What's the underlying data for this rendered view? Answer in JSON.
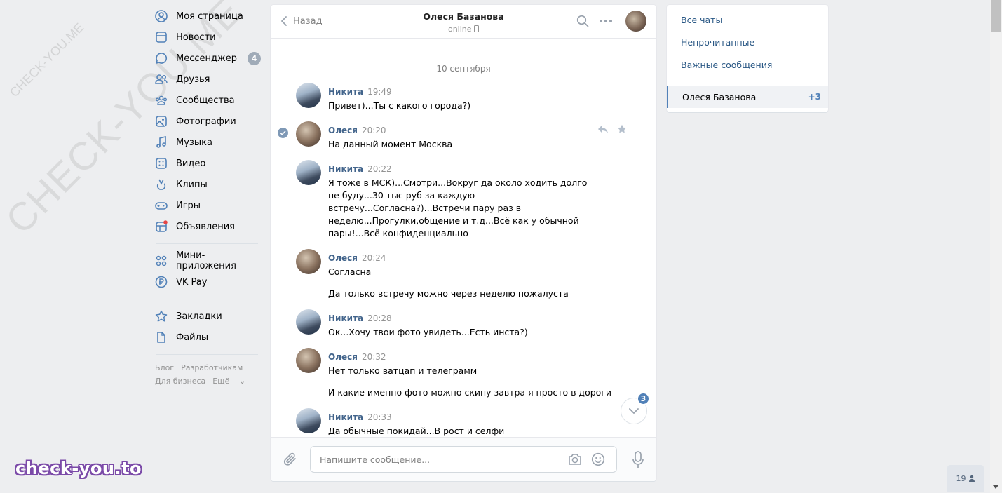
{
  "watermark": {
    "big": "CHECK-YOU.ME",
    "small": "CHECK-YOU.ME",
    "brand": "check-you.to"
  },
  "nav": {
    "items": [
      {
        "label": "Моя страница",
        "icon": "user-circle-icon"
      },
      {
        "label": "Новости",
        "icon": "news-icon"
      },
      {
        "label": "Мессенджер",
        "icon": "message-icon",
        "badge": "4"
      },
      {
        "label": "Друзья",
        "icon": "friends-icon"
      },
      {
        "label": "Сообщества",
        "icon": "communities-icon"
      },
      {
        "label": "Фотографии",
        "icon": "photo-icon"
      },
      {
        "label": "Музыка",
        "icon": "music-icon"
      },
      {
        "label": "Видео",
        "icon": "video-icon"
      },
      {
        "label": "Клипы",
        "icon": "clips-icon"
      },
      {
        "label": "Игры",
        "icon": "gamepad-icon"
      },
      {
        "label": "Объявления",
        "icon": "ads-icon"
      }
    ],
    "items2": [
      {
        "label": "Мини-приложения",
        "icon": "apps-icon"
      },
      {
        "label": "VK Pay",
        "icon": "vkpay-icon"
      }
    ],
    "items3": [
      {
        "label": "Закладки",
        "icon": "star-icon"
      },
      {
        "label": "Файлы",
        "icon": "file-icon"
      }
    ],
    "footer": [
      "Блог",
      "Разработчикам",
      "Для бизнеса",
      "Ещё"
    ]
  },
  "chat": {
    "back_label": "Назад",
    "peer_name": "Олеся Базанова",
    "peer_status": "online",
    "date": "10 сентября",
    "messages": [
      {
        "author": "Никита",
        "time": "19:49",
        "texts": [
          "Привет)...Ты с какого города?)"
        ],
        "who": "n"
      },
      {
        "author": "Олеся",
        "time": "20:20",
        "texts": [
          "На данный момент Москва"
        ],
        "who": "o"
      },
      {
        "author": "Никита",
        "time": "20:22",
        "texts": [
          "Я тоже в МСК)...Смотри...Вокруг да около ходить долго не буду...30 тыс руб за каждую встречу...Согласна?)...Встречи пару раз в неделю...Прогулки,общение и т.д...Всё как у обычной пары!...Всё конфиденциально"
        ],
        "who": "n"
      },
      {
        "author": "Олеся",
        "time": "20:24",
        "texts": [
          "Согласна",
          "Да только встречу можно через неделю пожалуста"
        ],
        "who": "o"
      },
      {
        "author": "Никита",
        "time": "20:28",
        "texts": [
          "Ок...Хочу твои фото увидеть...Есть инста?)"
        ],
        "who": "n"
      },
      {
        "author": "Олеся",
        "time": "20:32",
        "texts": [
          "Нет только ватцап и телеграмм",
          "И какие именно фото можно скину завтра я просто в дороги"
        ],
        "who": "o"
      },
      {
        "author": "Никита",
        "time": "20:33",
        "texts": [
          "Да обычные покидай...В рост и селфи"
        ],
        "who": "n"
      }
    ],
    "unread_count": "3",
    "composer_placeholder": "Напишите сообщение..."
  },
  "right": {
    "folders": [
      "Все чаты",
      "Непрочитанные",
      "Важные сообщения"
    ],
    "active_chat": "Олеся Базанова",
    "active_extra": "+3"
  },
  "online_count": "19",
  "colors": {
    "accent": "#5181b8",
    "link": "#2a5885",
    "author": "#42648b"
  }
}
